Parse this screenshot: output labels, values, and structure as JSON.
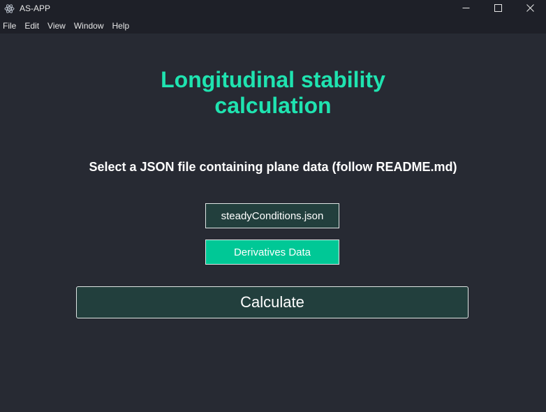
{
  "window": {
    "title": "AS-APP",
    "icon": "electron-atom-icon",
    "controls": [
      "minimize-icon",
      "maximize-icon",
      "close-icon"
    ]
  },
  "menu": {
    "items": [
      "File",
      "Edit",
      "View",
      "Window",
      "Help"
    ]
  },
  "page": {
    "title_line1": "Longitudinal stability",
    "title_line2": "calculation",
    "instructions": "Select a JSON file containing plane data (follow README.md)",
    "file_button": "steadyConditions.json",
    "derivatives_button": "Derivatives Data",
    "calculate_button": "Calculate"
  },
  "colors": {
    "background": "#272a33",
    "titlebar": "#1e2028",
    "accent": "#1fe3b0",
    "button_dark": "#223f3d",
    "button_teal": "#00c896"
  }
}
